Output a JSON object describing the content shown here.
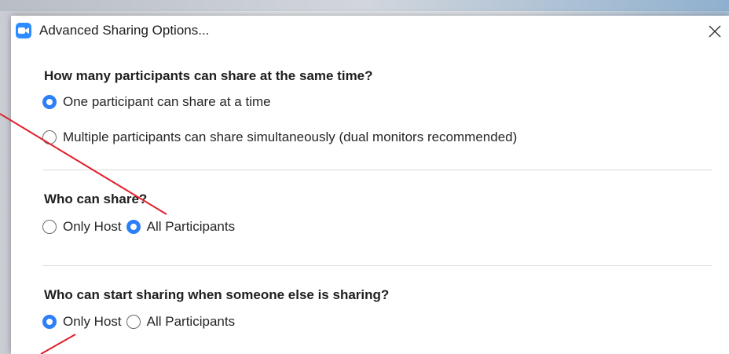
{
  "window": {
    "title": "Advanced Sharing Options...",
    "close_glyph": "✕",
    "app_icon": "zoom-camera-icon",
    "accent_color": "#2d8cff"
  },
  "sections": [
    {
      "question": "How many participants can share at the same time?",
      "options": [
        {
          "label": "One participant can share at a time",
          "selected": true
        },
        {
          "label": "Multiple participants can share simultaneously (dual monitors recommended)",
          "selected": false
        }
      ]
    },
    {
      "question": "Who can share?",
      "options": [
        {
          "label": "Only Host",
          "selected": false
        },
        {
          "label": "All Participants",
          "selected": true
        }
      ]
    },
    {
      "question": "Who can start sharing when someone else is sharing?",
      "options": [
        {
          "label": "Only Host",
          "selected": true
        },
        {
          "label": "All Participants",
          "selected": false
        }
      ]
    }
  ],
  "annotation_color": "#e0202a"
}
